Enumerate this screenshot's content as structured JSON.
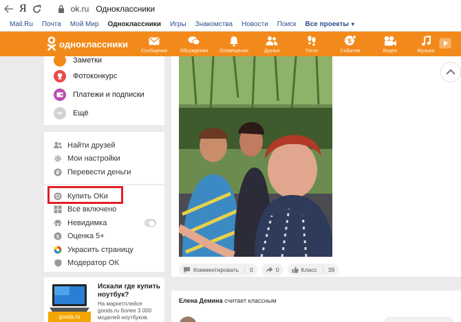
{
  "browser": {
    "back_icon": "arrow-left-icon",
    "ya": "Я",
    "reload_icon": "reload-icon",
    "url": "ok.ru",
    "title": "Одноклассники"
  },
  "portal": {
    "links": [
      "Mail.Ru",
      "Почта",
      "Мой Мир",
      "Одноклассники",
      "Игры",
      "Знакомства",
      "Новости",
      "Поиск",
      "Все проекты"
    ],
    "active": "Одноклассники"
  },
  "toolbar": {
    "logo": "одноклассники",
    "items": [
      {
        "label": "Сообщения",
        "icon": "envelope-icon"
      },
      {
        "label": "Обсуждения",
        "icon": "chat-icon"
      },
      {
        "label": "Оповещения",
        "icon": "bell-icon"
      },
      {
        "label": "Друзья",
        "icon": "friends-icon"
      },
      {
        "label": "Гости",
        "icon": "footprints-icon"
      },
      {
        "label": "События",
        "icon": "events-icon"
      },
      {
        "label": "Видео",
        "icon": "video-icon"
      },
      {
        "label": "Музыка",
        "icon": "music-icon"
      }
    ],
    "accent": "#f28a1b"
  },
  "menu1": [
    {
      "label": "Заметки",
      "color": "#f28a1b"
    },
    {
      "label": "Фотоконкурс",
      "color": "#e84c4c"
    },
    {
      "label": "Платежи и подписки",
      "color": "#b84fb0"
    },
    {
      "label": "Ещё",
      "color": "#cccccc"
    }
  ],
  "menu2": [
    {
      "label": "Найти друзей",
      "icon": "find-friends-icon"
    },
    {
      "label": "Мои настройки",
      "icon": "gear-icon"
    },
    {
      "label": "Перевести деньги",
      "icon": "money-transfer-icon"
    }
  ],
  "menu3": [
    {
      "label": "Купить ОКи",
      "icon": "coin-icon"
    },
    {
      "label": "Всё включено",
      "icon": "all-included-icon"
    },
    {
      "label": "Невидимка",
      "icon": "invisible-icon"
    },
    {
      "label": "Оценка 5+",
      "icon": "rating-icon"
    },
    {
      "label": "Украсить страницу",
      "icon": "decorate-icon"
    },
    {
      "label": "Модератор ОК",
      "icon": "moderator-icon"
    }
  ],
  "ad": {
    "badge": "goods.ru",
    "title": "Искали где купить ноутбук?",
    "text": "На маркетплейсе goods.ru более 3 000 моделей ноутбуков."
  },
  "post": {
    "comment_label": "Комментировать",
    "comment_count": "0",
    "share_count": "0",
    "like_label": "Класс",
    "like_count": "39"
  },
  "feed2": {
    "author": "Елена Демина",
    "action": "считает классным"
  }
}
